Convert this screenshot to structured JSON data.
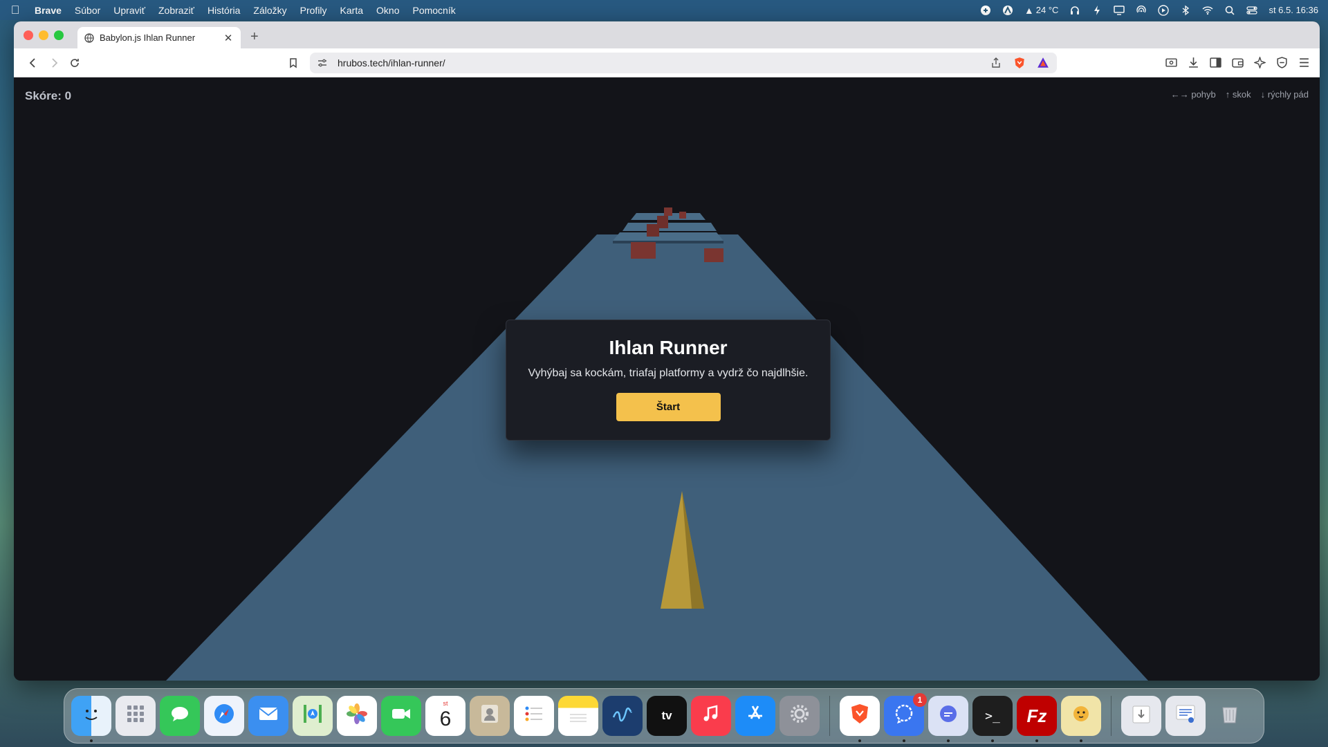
{
  "menubar": {
    "app_name": "Brave",
    "items": [
      "Súbor",
      "Upraviť",
      "Zobraziť",
      "História",
      "Záložky",
      "Profily",
      "Karta",
      "Okno",
      "Pomocník"
    ],
    "weather": "24 °C",
    "datetime": "st 6.5.  16:36"
  },
  "browser": {
    "tab_title": "Babylon.js Ihlan Runner",
    "url": "hrubos.tech/ihlan-runner/"
  },
  "game": {
    "score_label": "Skóre: 0",
    "controls": {
      "move": "←→ pohyb",
      "jump": "↑ skok",
      "drop": "↓ rýchly pád"
    },
    "modal": {
      "title": "Ihlan Runner",
      "subtitle": "Vyhýbaj sa kockám, triafaj platformy a vydrž čo najdlhšie.",
      "start_label": "Štart"
    },
    "colors": {
      "track": "#3f5f7a",
      "obstacle": "#7a3530",
      "player": "#b8993a",
      "button": "#f4c14c"
    }
  },
  "dock": {
    "calendar_day": "st",
    "calendar_date": "6",
    "signal_badge": "1",
    "apps": [
      "Finder",
      "Launchpad",
      "Messages",
      "Safari",
      "Mail",
      "Maps",
      "Photos",
      "FaceTime",
      "Calendar",
      "Contacts",
      "Reminders",
      "Notes",
      "Freeform",
      "Apple TV",
      "Music",
      "App Store",
      "System Settings",
      "Brave",
      "Signal",
      "Element",
      "Terminal",
      "FileZilla",
      "Cheetah",
      "Downloads",
      "Documents",
      "Trash"
    ]
  }
}
